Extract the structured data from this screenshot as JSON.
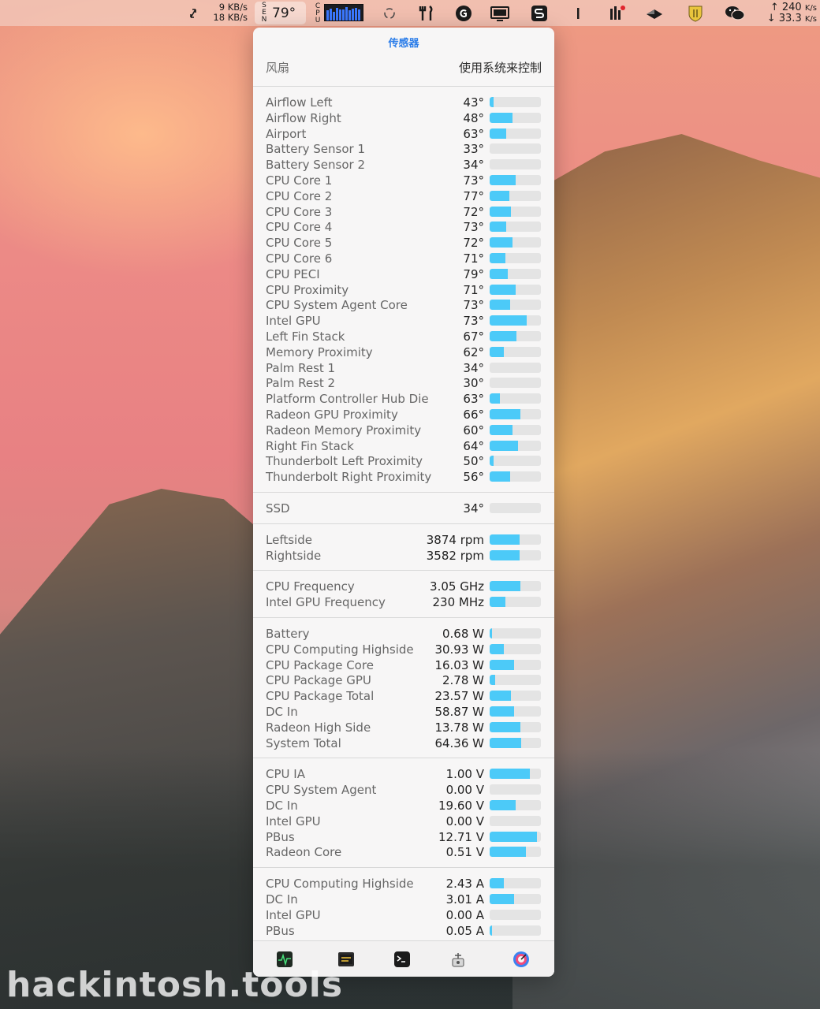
{
  "menubar": {
    "net_up": "9 KB/s",
    "net_down": "18 KB/s",
    "sen_label": "SEN",
    "temperature": "79°",
    "cpu_label": "CPU",
    "speed_up": "240",
    "speed_up_unit": "K/s",
    "speed_down": "33.3",
    "speed_down_unit": "K/s",
    "cpu_history": [
      0.7,
      0.85,
      0.6,
      0.9,
      0.75,
      0.8,
      0.95,
      0.7,
      0.85,
      0.9,
      0.8
    ]
  },
  "panel": {
    "title": "传感器",
    "fan_label": "风扇",
    "fan_mode": "使用系统来控制"
  },
  "groups": [
    {
      "rows": [
        {
          "name": "Airflow Left",
          "value": "43°",
          "level": 0.08
        },
        {
          "name": "Airflow Right",
          "value": "48°",
          "level": 0.45
        },
        {
          "name": "Airport",
          "value": "63°",
          "level": 0.33
        },
        {
          "name": "Battery Sensor 1",
          "value": "33°",
          "level": 0
        },
        {
          "name": "Battery Sensor 2",
          "value": "34°",
          "level": 0
        },
        {
          "name": "CPU Core 1",
          "value": "73°",
          "level": 0.5
        },
        {
          "name": "CPU Core 2",
          "value": "77°",
          "level": 0.38
        },
        {
          "name": "CPU Core 3",
          "value": "72°",
          "level": 0.42
        },
        {
          "name": "CPU Core 4",
          "value": "73°",
          "level": 0.33
        },
        {
          "name": "CPU Core 5",
          "value": "72°",
          "level": 0.45
        },
        {
          "name": "CPU Core 6",
          "value": "71°",
          "level": 0.3
        },
        {
          "name": "CPU PECI",
          "value": "79°",
          "level": 0.35
        },
        {
          "name": "CPU Proximity",
          "value": "71°",
          "level": 0.5
        },
        {
          "name": "CPU System Agent Core",
          "value": "73°",
          "level": 0.4
        },
        {
          "name": "Intel GPU",
          "value": "73°",
          "level": 0.72
        },
        {
          "name": "Left Fin Stack",
          "value": "67°",
          "level": 0.52
        },
        {
          "name": "Memory Proximity",
          "value": "62°",
          "level": 0.28
        },
        {
          "name": "Palm Rest 1",
          "value": "34°",
          "level": 0
        },
        {
          "name": "Palm Rest 2",
          "value": "30°",
          "level": 0
        },
        {
          "name": "Platform Controller Hub Die",
          "value": "63°",
          "level": 0.2
        },
        {
          "name": "Radeon GPU Proximity",
          "value": "66°",
          "level": 0.6
        },
        {
          "name": "Radeon Memory Proximity",
          "value": "60°",
          "level": 0.45
        },
        {
          "name": "Right Fin Stack",
          "value": "64°",
          "level": 0.55
        },
        {
          "name": "Thunderbolt Left Proximity",
          "value": "50°",
          "level": 0.08
        },
        {
          "name": "Thunderbolt Right Proximity",
          "value": "56°",
          "level": 0.4
        }
      ]
    },
    {
      "rows": [
        {
          "name": "SSD",
          "value": "34°",
          "level": 0
        }
      ]
    },
    {
      "rows": [
        {
          "name": "Leftside",
          "value": "3874 rpm",
          "level": 0.58
        },
        {
          "name": "Rightside",
          "value": "3582 rpm",
          "level": 0.58
        }
      ]
    },
    {
      "rows": [
        {
          "name": "CPU Frequency",
          "value": "3.05 GHz",
          "level": 0.6
        },
        {
          "name": "Intel GPU Frequency",
          "value": "230 MHz",
          "level": 0.3
        }
      ]
    },
    {
      "rows": [
        {
          "name": "Battery",
          "value": "0.68 W",
          "level": 0.03
        },
        {
          "name": "CPU Computing Highside",
          "value": "30.93 W",
          "level": 0.28
        },
        {
          "name": "CPU Package Core",
          "value": "16.03 W",
          "level": 0.48
        },
        {
          "name": "CPU Package GPU",
          "value": "2.78 W",
          "level": 0.1
        },
        {
          "name": "CPU Package Total",
          "value": "23.57 W",
          "level": 0.42
        },
        {
          "name": "DC In",
          "value": "58.87 W",
          "level": 0.48
        },
        {
          "name": "Radeon High Side",
          "value": "13.78 W",
          "level": 0.6
        },
        {
          "name": "System Total",
          "value": "64.36 W",
          "level": 0.62
        }
      ]
    },
    {
      "rows": [
        {
          "name": "CPU IA",
          "value": "1.00 V",
          "level": 0.78
        },
        {
          "name": "CPU System Agent",
          "value": "0.00 V",
          "level": 0
        },
        {
          "name": "DC In",
          "value": "19.60 V",
          "level": 0.5
        },
        {
          "name": "Intel GPU",
          "value": "0.00 V",
          "level": 0
        },
        {
          "name": "PBus",
          "value": "12.71 V",
          "level": 0.92
        },
        {
          "name": "Radeon Core",
          "value": "0.51 V",
          "level": 0.7
        }
      ]
    },
    {
      "rows": [
        {
          "name": "CPU Computing Highside",
          "value": "2.43 A",
          "level": 0.28
        },
        {
          "name": "DC In",
          "value": "3.01 A",
          "level": 0.48
        },
        {
          "name": "Intel GPU",
          "value": "0.00 A",
          "level": 0
        },
        {
          "name": "PBus",
          "value": "0.05 A",
          "level": 0.03
        }
      ]
    }
  ],
  "footer": {
    "icons": [
      "activity-monitor-icon",
      "istat-icon",
      "terminal-icon",
      "system-info-icon",
      "disk-utility-icon"
    ]
  },
  "watermark": "hackintosh.tools"
}
